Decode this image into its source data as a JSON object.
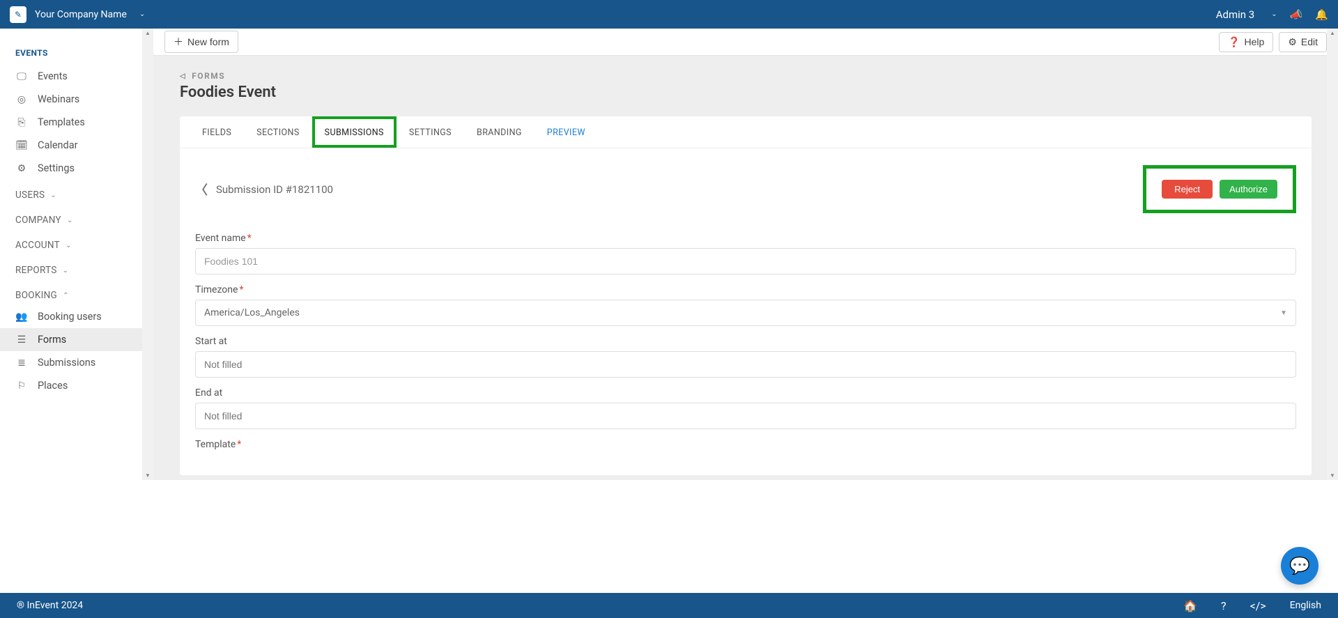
{
  "topbar": {
    "company": "Your Company Name",
    "user": "Admin 3"
  },
  "sidebar": {
    "events_title": "EVENTS",
    "events_items": [
      {
        "label": "Events",
        "icon": "🖵"
      },
      {
        "label": "Webinars",
        "icon": "◎"
      },
      {
        "label": "Templates",
        "icon": "⎘"
      },
      {
        "label": "Calendar",
        "icon": "🗓"
      },
      {
        "label": "Settings",
        "icon": "⚙"
      }
    ],
    "groups": [
      {
        "label": "USERS",
        "chev": "⌄"
      },
      {
        "label": "COMPANY",
        "chev": "⌄"
      },
      {
        "label": "ACCOUNT",
        "chev": "⌄"
      },
      {
        "label": "REPORTS",
        "chev": "⌄"
      },
      {
        "label": "BOOKING",
        "chev": "⌃"
      }
    ],
    "booking_items": [
      {
        "label": "Booking users",
        "icon": "👥"
      },
      {
        "label": "Forms",
        "icon": "☰",
        "active": true
      },
      {
        "label": "Submissions",
        "icon": "≣"
      },
      {
        "label": "Places",
        "icon": "⚐"
      }
    ]
  },
  "toolbar": {
    "new_form": "New form",
    "help": "Help",
    "edit": "Edit"
  },
  "breadcrumb": {
    "back": "◁",
    "label": "FORMS"
  },
  "page_title": "Foodies Event",
  "tabs": [
    "FIELDS",
    "SECTIONS",
    "SUBMISSIONS",
    "SETTINGS",
    "BRANDING",
    "PREVIEW"
  ],
  "submission": {
    "id_label": "Submission ID #1821100",
    "reject": "Reject",
    "authorize": "Authorize",
    "fields": {
      "event_name_label": "Event name",
      "event_name_value": "Foodies 101",
      "timezone_label": "Timezone",
      "timezone_value": "America/Los_Angeles",
      "start_label": "Start at",
      "start_placeholder": "Not filled",
      "end_label": "End at",
      "end_placeholder": "Not filled",
      "template_label": "Template"
    }
  },
  "footer": {
    "copyright": "® InEvent 2024",
    "language": "English"
  }
}
